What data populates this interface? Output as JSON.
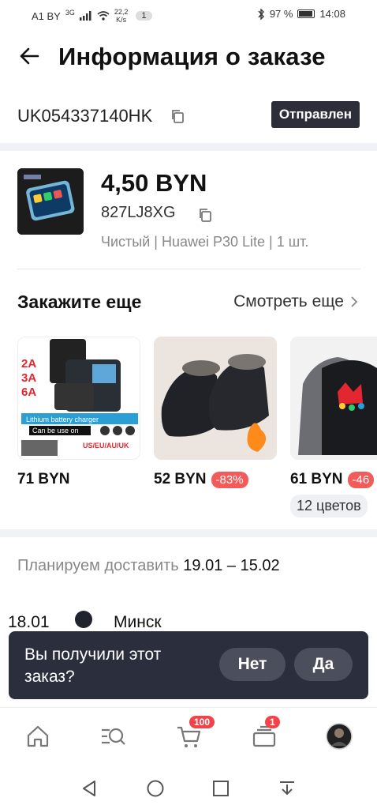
{
  "status_bar": {
    "carrier": "A1 BY",
    "network": "3G",
    "speed": "22,2",
    "speed_unit": "K/s",
    "notif_count": "1",
    "battery": "97 %",
    "time": "14:08"
  },
  "header": {
    "title": "Информация о заказе"
  },
  "order": {
    "tracking_number": "UK054337140HK",
    "status": "Отправлен"
  },
  "product": {
    "price": "4,50 BYN",
    "sku": "827LJ8XG",
    "variant": "Чистый | Huawei P30 Lite | 1 шт."
  },
  "recommendations": {
    "title": "Закажите еще",
    "see_more": "Смотреть еще",
    "items": [
      {
        "price": "71 BYN",
        "discount": "",
        "colors": ""
      },
      {
        "price": "52 BYN",
        "discount": "-83%",
        "colors": ""
      },
      {
        "price": "61 BYN",
        "discount": "-46",
        "colors": "12 цветов"
      }
    ],
    "item1_img_text": [
      "2A",
      "3A",
      "6A",
      "Lithium battery charger",
      "Can be use on",
      "US/EU/AU/UK"
    ]
  },
  "delivery": {
    "label": "Планируем доставить",
    "range": "19.01 – 15.02",
    "event_date": "18.01",
    "event_city": "Минск"
  },
  "toast": {
    "question": "Вы получили этот заказ?",
    "no": "Нет",
    "yes": "Да"
  },
  "nav": {
    "cart_badge": "100",
    "orders_badge": "1",
    "icons": [
      "home-icon",
      "search-list-icon",
      "cart-icon",
      "orders-icon",
      "profile-avatar"
    ]
  },
  "colors": {
    "dark": "#2c2f3a",
    "discount": "#f35b5b",
    "badge": "#f0444a"
  }
}
